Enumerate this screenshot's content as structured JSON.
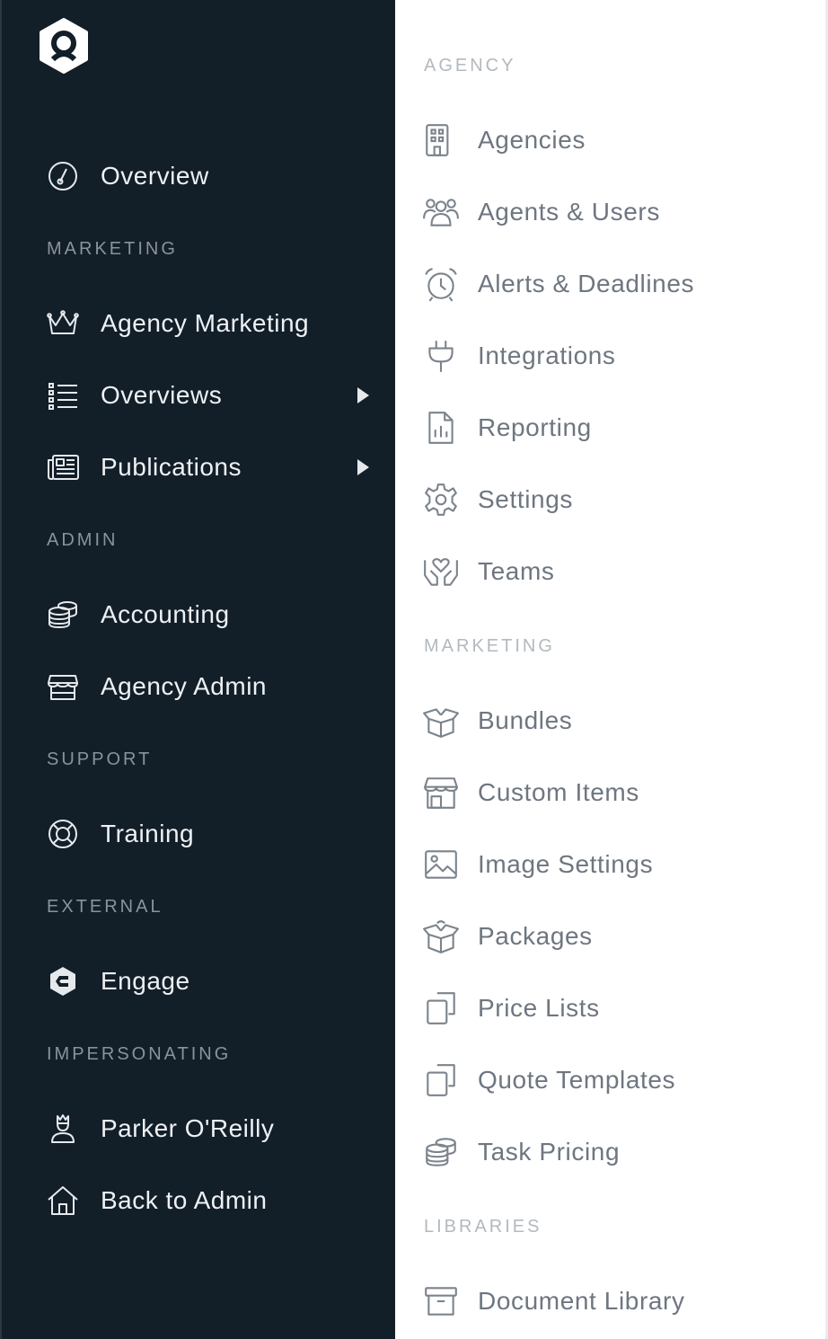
{
  "sidebar": {
    "logo": "app-logo-icon",
    "items": {
      "overview": {
        "label": "Overview",
        "icon": "dashboard-gauge-icon"
      },
      "agency_marketing": {
        "label": "Agency Marketing",
        "icon": "crown-icon"
      },
      "overviews": {
        "label": "Overviews",
        "icon": "list-icon"
      },
      "publications": {
        "label": "Publications",
        "icon": "newspaper-icon"
      },
      "accounting": {
        "label": "Accounting",
        "icon": "coins-icon"
      },
      "agency_admin": {
        "label": "Agency Admin",
        "icon": "storefront-icon"
      },
      "training": {
        "label": "Training",
        "icon": "lifebuoy-icon"
      },
      "engage": {
        "label": "Engage",
        "icon": "engage-logo-icon"
      },
      "parker": {
        "label": "Parker O'Reilly",
        "icon": "user-crown-icon"
      },
      "back_to_admin": {
        "label": "Back to Admin",
        "icon": "home-icon"
      }
    },
    "sections": {
      "marketing": "MARKETING",
      "admin": "ADMIN",
      "support": "SUPPORT",
      "external": "EXTERNAL",
      "impersonating": "IMPERSONATING"
    }
  },
  "flyout": {
    "sections": {
      "agency": "AGENCY",
      "marketing": "MARKETING",
      "libraries": "LIBRARIES"
    },
    "items": {
      "agencies": {
        "label": "Agencies",
        "icon": "building-icon"
      },
      "agents_users": {
        "label": "Agents & Users",
        "icon": "users-icon"
      },
      "alerts": {
        "label": "Alerts & Deadlines",
        "icon": "alarm-clock-icon"
      },
      "integrations": {
        "label": "Integrations",
        "icon": "plug-icon"
      },
      "reporting": {
        "label": "Reporting",
        "icon": "report-file-icon"
      },
      "settings": {
        "label": "Settings",
        "icon": "gear-icon"
      },
      "teams": {
        "label": "Teams",
        "icon": "hands-heart-icon"
      },
      "bundles": {
        "label": "Bundles",
        "icon": "open-box-icon"
      },
      "custom_items": {
        "label": "Custom Items",
        "icon": "storefront-icon"
      },
      "image_settings": {
        "label": "Image Settings",
        "icon": "image-icon"
      },
      "packages": {
        "label": "Packages",
        "icon": "open-box-icon"
      },
      "price_lists": {
        "label": "Price Lists",
        "icon": "copy-icon"
      },
      "quote_templates": {
        "label": "Quote Templates",
        "icon": "copy-icon"
      },
      "task_pricing": {
        "label": "Task Pricing",
        "icon": "coins-icon"
      },
      "document_library": {
        "label": "Document Library",
        "icon": "archive-icon"
      }
    }
  },
  "colors": {
    "sidebar_bg": "#121e28",
    "sidebar_text": "#eef1f4",
    "section_text": "#8a939c",
    "flyout_text": "#6e7680",
    "flyout_section": "#b3b9bf"
  }
}
